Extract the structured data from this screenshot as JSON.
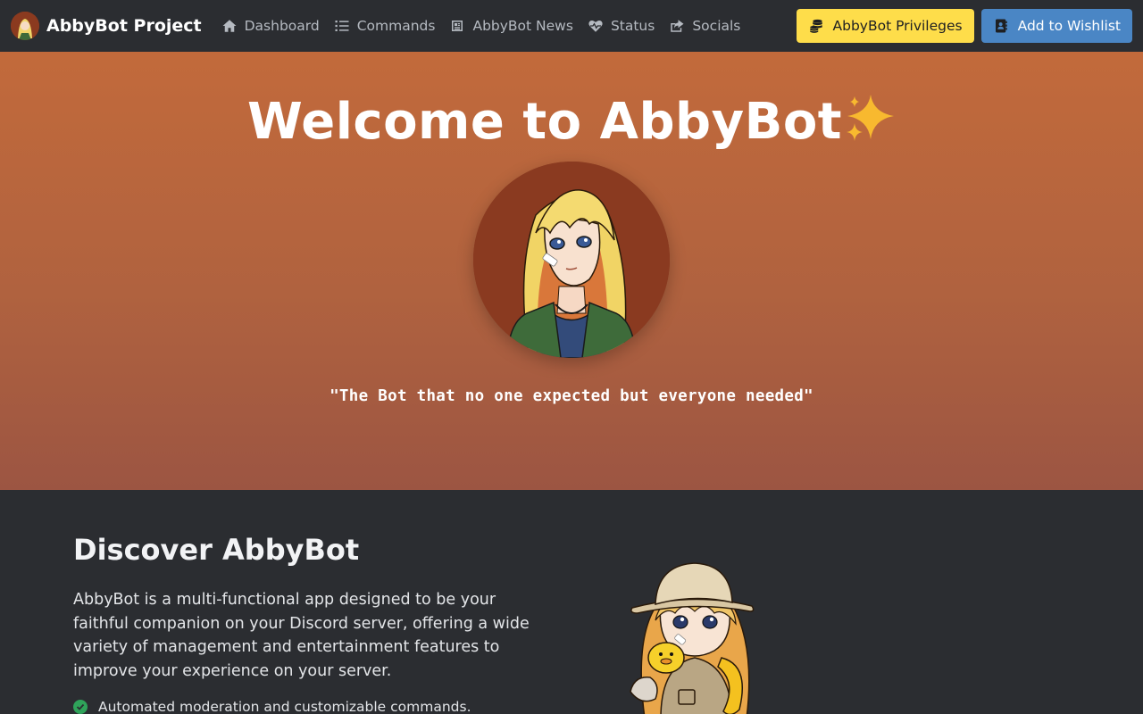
{
  "brand": {
    "name": "AbbyBot Project"
  },
  "nav": {
    "links": [
      {
        "label": "Dashboard",
        "icon": "home-icon"
      },
      {
        "label": "Commands",
        "icon": "list-icon"
      },
      {
        "label": "AbbyBot News",
        "icon": "newspaper-icon"
      },
      {
        "label": "Status",
        "icon": "heartbeat-icon"
      },
      {
        "label": "Socials",
        "icon": "share-icon"
      }
    ],
    "privileges_label": "AbbyBot Privileges",
    "wishlist_label": "Add to Wishlist"
  },
  "hero": {
    "title": "Welcome to AbbyBot",
    "title_emoji": "✨",
    "tagline": "\"The Bot that no one expected but everyone needed\""
  },
  "discover": {
    "title": "Discover AbbyBot",
    "description": "AbbyBot is a multi-functional app designed to be your faithful companion on your Discord server, offering a wide variety of management and entertainment features to improve your experience on your server.",
    "features": [
      "Automated moderation and customizable commands."
    ]
  },
  "colors": {
    "navbar_bg": "#2b2d31",
    "hero_top": "#c26a3b",
    "hero_bottom": "#9c5542",
    "privileges_button": "#fedd4a",
    "wishlist_button": "#4a86c5",
    "check_green": "#2fa35a"
  }
}
